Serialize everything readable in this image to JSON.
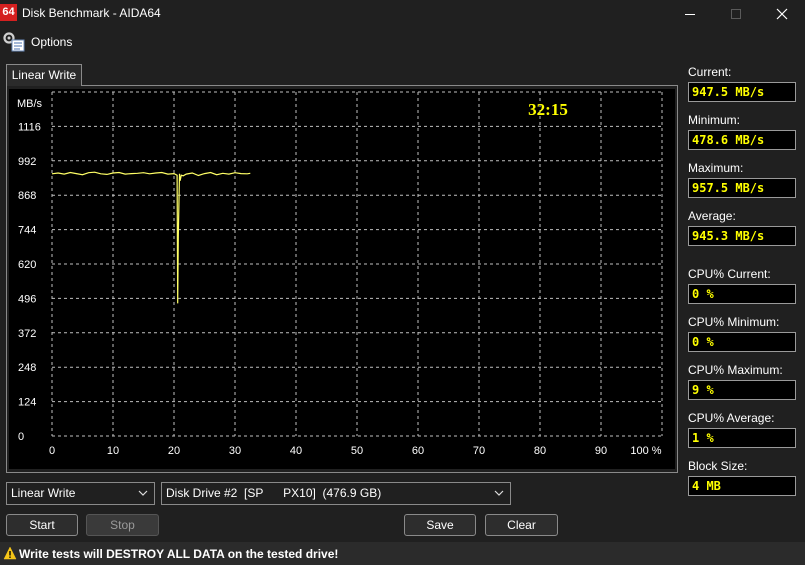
{
  "window": {
    "logo_text": "64",
    "title": "Disk Benchmark - AIDA64"
  },
  "menu": {
    "options_label": "Options"
  },
  "tab": {
    "label": "Linear Write"
  },
  "chart_data": {
    "type": "line",
    "ylabel": "MB/s",
    "timer": "32:15",
    "y_ticks": [
      0,
      124,
      248,
      372,
      496,
      620,
      744,
      868,
      992,
      1116
    ],
    "ylim": [
      0,
      1240
    ],
    "x_ticks": [
      "0",
      "10",
      "20",
      "30",
      "40",
      "50",
      "60",
      "70",
      "80",
      "90",
      "100 %"
    ],
    "xlim": [
      0,
      100
    ],
    "grid": true,
    "series": [
      {
        "color": "#ffff66",
        "x": [
          0,
          1,
          2,
          3,
          4,
          5,
          6,
          7,
          8,
          9,
          10,
          11,
          12,
          13,
          14,
          15,
          16,
          17,
          18,
          19,
          20,
          20.5,
          20.6,
          20.7,
          20.9,
          21,
          21.2,
          21.5,
          22,
          23,
          24,
          25,
          26,
          27,
          28,
          29,
          30,
          31,
          32,
          32.5
        ],
        "y": [
          945,
          948,
          944,
          950,
          946,
          942,
          949,
          951,
          945,
          943,
          948,
          950,
          944,
          946,
          947,
          949,
          945,
          948,
          950,
          944,
          946,
          940,
          478,
          720,
          945,
          920,
          940,
          938,
          944,
          948,
          939,
          946,
          950,
          942,
          947,
          944,
          949,
          946,
          945,
          947
        ]
      }
    ]
  },
  "stats": {
    "current_label": "Current:",
    "current_value": "947.5 MB/s",
    "minimum_label": "Minimum:",
    "minimum_value": "478.6 MB/s",
    "maximum_label": "Maximum:",
    "maximum_value": "957.5 MB/s",
    "average_label": "Average:",
    "average_value": "945.3 MB/s",
    "cpu_current_label": "CPU% Current:",
    "cpu_current_value": "0 %",
    "cpu_minimum_label": "CPU% Minimum:",
    "cpu_minimum_value": "0 %",
    "cpu_maximum_label": "CPU% Maximum:",
    "cpu_maximum_value": "9 %",
    "cpu_average_label": "CPU% Average:",
    "cpu_average_value": "1 %",
    "block_size_label": "Block Size:",
    "block_size_value": "4 MB"
  },
  "controls": {
    "test_select_value": "Linear Write",
    "drive_select_value": "Disk Drive #2  [SP      PX10]  (476.9 GB)",
    "start_label": "Start",
    "stop_label": "Stop",
    "save_label": "Save",
    "clear_label": "Clear"
  },
  "warning": {
    "text": "Write tests will DESTROY ALL DATA on the tested drive!"
  },
  "colors": {
    "accent_logo": "#d42020",
    "value_text": "#ffff00",
    "chart_line": "#ffff66",
    "background": "#202020"
  }
}
